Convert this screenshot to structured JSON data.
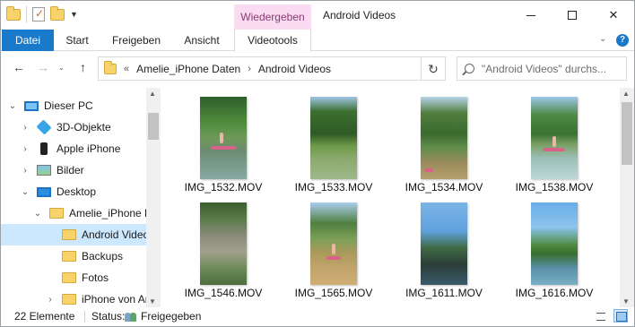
{
  "titlebar": {
    "context_tab_title": "Wiedergeben",
    "window_title": "Android Videos"
  },
  "ribbon": {
    "tabs": [
      "Datei",
      "Start",
      "Freigeben",
      "Ansicht",
      "Videotools"
    ],
    "help": "?"
  },
  "address": {
    "overflow": "«",
    "segments": [
      "Amelie_iPhone Daten",
      "Android Videos"
    ]
  },
  "search": {
    "placeholder": "\"Android Videos\" durchs..."
  },
  "navtree": [
    {
      "label": "Dieser PC",
      "icon": "pc-icon",
      "expanded": true,
      "indent": 0,
      "selected": false
    },
    {
      "label": "3D-Objekte",
      "icon": "3d-objects-icon",
      "expanded": false,
      "indent": 1,
      "selected": false
    },
    {
      "label": "Apple iPhone",
      "icon": "phone-icon",
      "expanded": false,
      "indent": 1,
      "selected": false
    },
    {
      "label": "Bilder",
      "icon": "pictures-icon",
      "expanded": false,
      "indent": 1,
      "selected": false
    },
    {
      "label": "Desktop",
      "icon": "desktop-icon",
      "expanded": true,
      "indent": 1,
      "selected": false
    },
    {
      "label": "Amelie_iPhone Daten",
      "icon": "folder-icon",
      "expanded": true,
      "indent": 2,
      "selected": false
    },
    {
      "label": "Android Videos",
      "icon": "folder-icon",
      "expanded": null,
      "indent": 3,
      "selected": true
    },
    {
      "label": "Backups",
      "icon": "folder-icon",
      "expanded": null,
      "indent": 3,
      "selected": false
    },
    {
      "label": "Fotos",
      "icon": "folder-icon",
      "expanded": null,
      "indent": 3,
      "selected": false
    },
    {
      "label": "iPhone von Amelie",
      "icon": "folder-icon",
      "expanded": false,
      "indent": 3,
      "selected": false
    }
  ],
  "files": [
    {
      "name": "IMG_1532.MOV",
      "scene": "lake-paddleboard"
    },
    {
      "name": "IMG_1533.MOV",
      "scene": "lake-trees"
    },
    {
      "name": "IMG_1534.MOV",
      "scene": "lake-shore-board"
    },
    {
      "name": "IMG_1538.MOV",
      "scene": "lake-paddler"
    },
    {
      "name": "IMG_1546.MOV",
      "scene": "rock-cliff"
    },
    {
      "name": "IMG_1565.MOV",
      "scene": "lake-standing"
    },
    {
      "name": "IMG_1611.MOV",
      "scene": "lake-rock-dark"
    },
    {
      "name": "IMG_1616.MOV",
      "scene": "lake-wide"
    }
  ],
  "status": {
    "item_count": "22 Elemente",
    "label": "Status:",
    "share_state": "Freigegeben"
  }
}
